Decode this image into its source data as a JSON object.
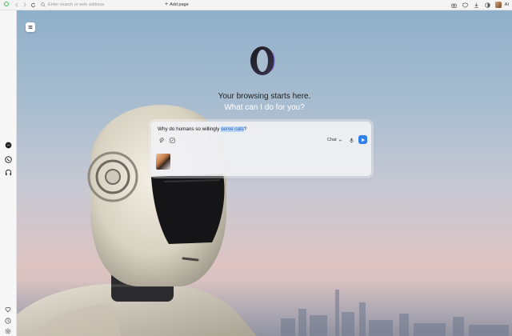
{
  "toolbar": {
    "address_placeholder": "Enter search or web address",
    "add_page_label": "Add page",
    "ai_label": "AI"
  },
  "hero": {
    "headline": "Your browsing starts here.",
    "subline": "What can I do for you?"
  },
  "chat": {
    "prompt_before": "Why do humans so willingly ",
    "prompt_selected": "serve cats",
    "prompt_after": "?",
    "mode_label": "Chat"
  },
  "colors": {
    "accent": "#2f80ed",
    "selection": "#b9d4f4",
    "sidebar_bg": "#f7f7f8"
  },
  "icons": {
    "sidebar": [
      "messenger-icon",
      "whatsapp-icon",
      "headphones-icon",
      "heart-icon",
      "clock-icon",
      "settings-icon"
    ],
    "toolbar_right": [
      "camera-icon",
      "shield-icon",
      "download-icon",
      "contrast-icon",
      "avatar",
      "ai-label"
    ]
  }
}
